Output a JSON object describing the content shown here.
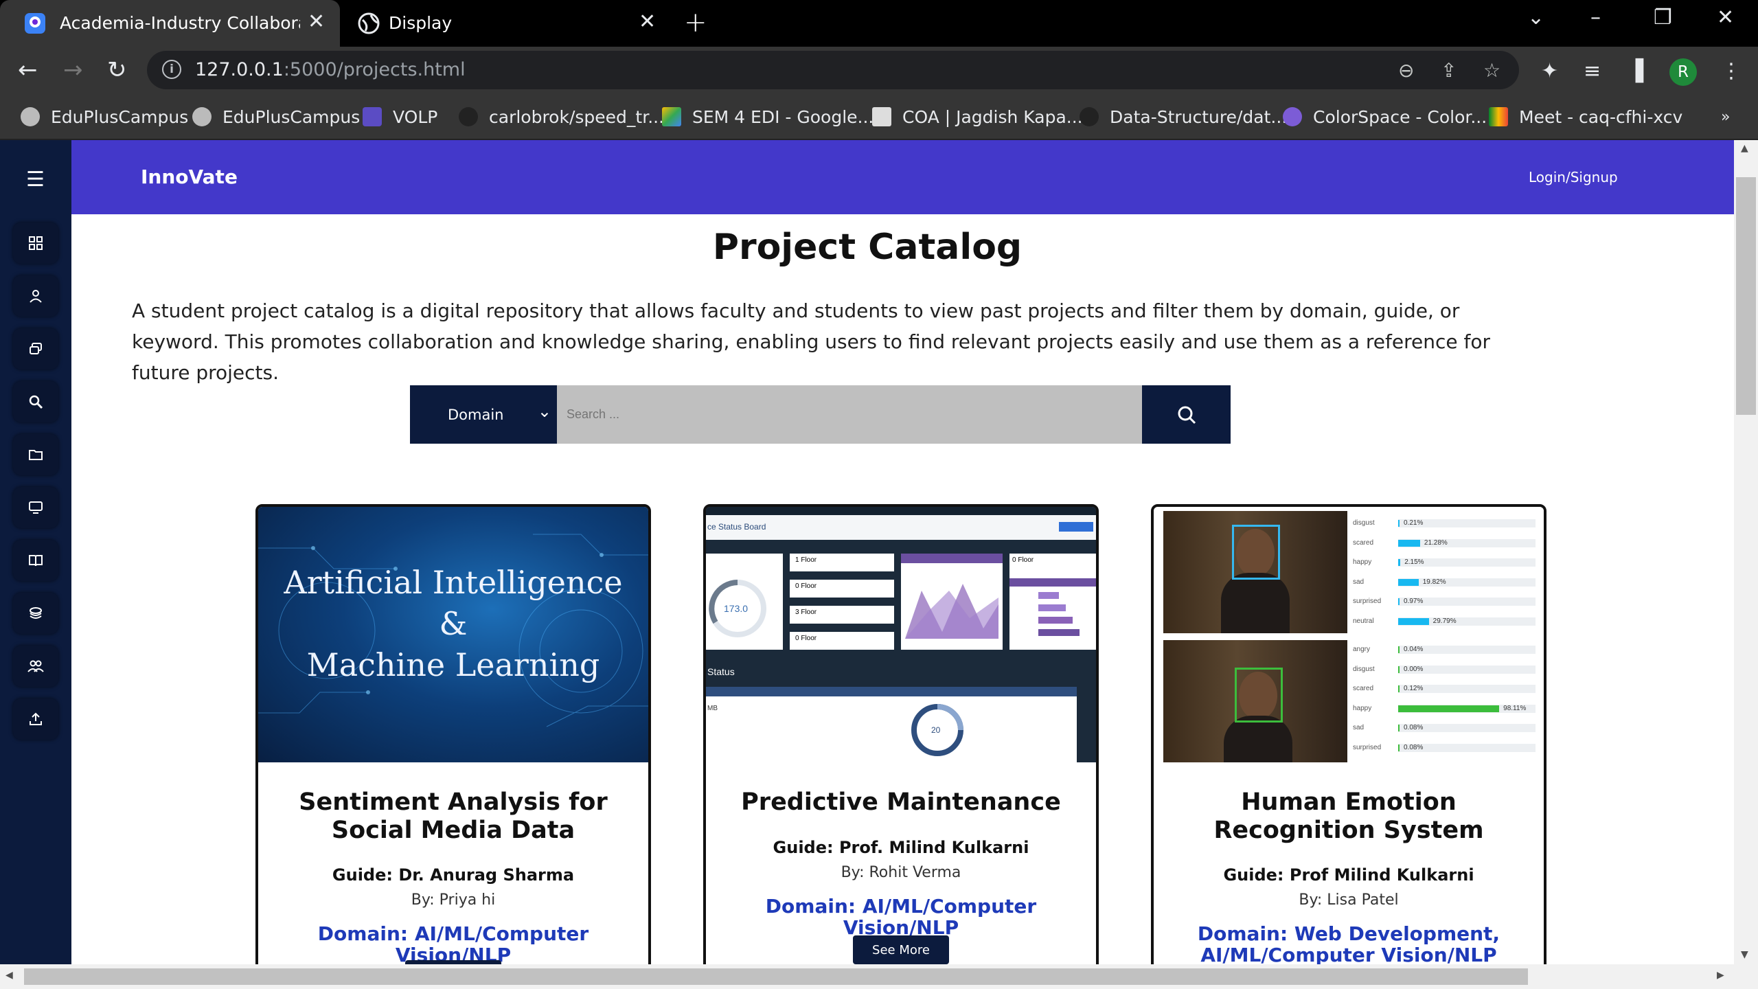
{
  "browser": {
    "tabs": [
      {
        "title": "Academia-Industry Collaboration"
      },
      {
        "title": "Display"
      }
    ],
    "url_host": "127.0.0.1",
    "url_rest": ":5000/projects.html",
    "avatar_letter": "R",
    "bookmarks": [
      "EduPlusCampus",
      "EduPlusCampus",
      "VOLP",
      "carlobrok/speed_tr...",
      "SEM 4 EDI - Google...",
      "COA | Jagdish Kapa...",
      "Data-Structure/dat...",
      "ColorSpace - Color...",
      "Meet - caq-cfhi-xcv"
    ]
  },
  "nav": {
    "brand": "InnoVate",
    "login": "Login/Signup"
  },
  "page": {
    "title": "Project Catalog",
    "intro": "A student project catalog is a digital repository that allows faculty and students to view past projects and filter them by domain, guide, or keyword. This promotes collaboration and knowledge sharing, enabling users to find relevant projects easily and use them as a reference for future projects."
  },
  "search": {
    "domain_label": "Domain",
    "placeholder": "Search ..."
  },
  "projects": [
    {
      "image_text_1": "Artificial Intelligence",
      "image_text_2": "&",
      "image_text_3": "Machine Learning",
      "title": "Sentiment Analysis for Social Media Data",
      "guide": "Guide: Dr. Anurag Sharma",
      "by": "By: Priya hi",
      "domain": "Domain: AI/ML/Computer Vision/NLP"
    },
    {
      "dash_header": "ce Status Board",
      "dash_floor_1": "1 Floor",
      "dash_floor_2": "0 Floor",
      "dash_floor_3": "3 Floor",
      "dash_floor_4": "0 Floor",
      "dash_floor_5": "0 Floor",
      "dash_gauge": "173.0",
      "dash_status": "Status",
      "dash_mb": "MB",
      "dash_ring": "20",
      "title": "Predictive Maintenance",
      "guide": "Guide: Prof. Milind Kulkarni",
      "by": "By: Rohit Verma",
      "domain": "Domain: AI/ML/Computer Vision/NLP",
      "button": "See More"
    },
    {
      "emo1": [
        {
          "label": "disgust",
          "pct": "0.21%"
        },
        {
          "label": "scared",
          "pct": "21.28%"
        },
        {
          "label": "happy",
          "pct": "2.15%"
        },
        {
          "label": "sad",
          "pct": "19.82%"
        },
        {
          "label": "surprised",
          "pct": "0.97%"
        },
        {
          "label": "neutral",
          "pct": "29.79%"
        }
      ],
      "emo2": [
        {
          "label": "angry",
          "pct": "0.04%"
        },
        {
          "label": "disgust",
          "pct": "0.00%"
        },
        {
          "label": "scared",
          "pct": "0.12%"
        },
        {
          "label": "happy",
          "pct": "98.11%"
        },
        {
          "label": "sad",
          "pct": "0.08%"
        },
        {
          "label": "surprised",
          "pct": "0.08%"
        }
      ],
      "title": "Human Emotion Recognition System",
      "guide": "Guide: Prof Milind Kulkarni",
      "by": "By: Lisa Patel",
      "domain": "Domain: Web Development, AI/ML/Computer Vision/NLP"
    }
  ],
  "colors": {
    "navbar": "#4338ca",
    "sidebar": "#0c1b3d",
    "domain_link": "#1e3ab8"
  }
}
